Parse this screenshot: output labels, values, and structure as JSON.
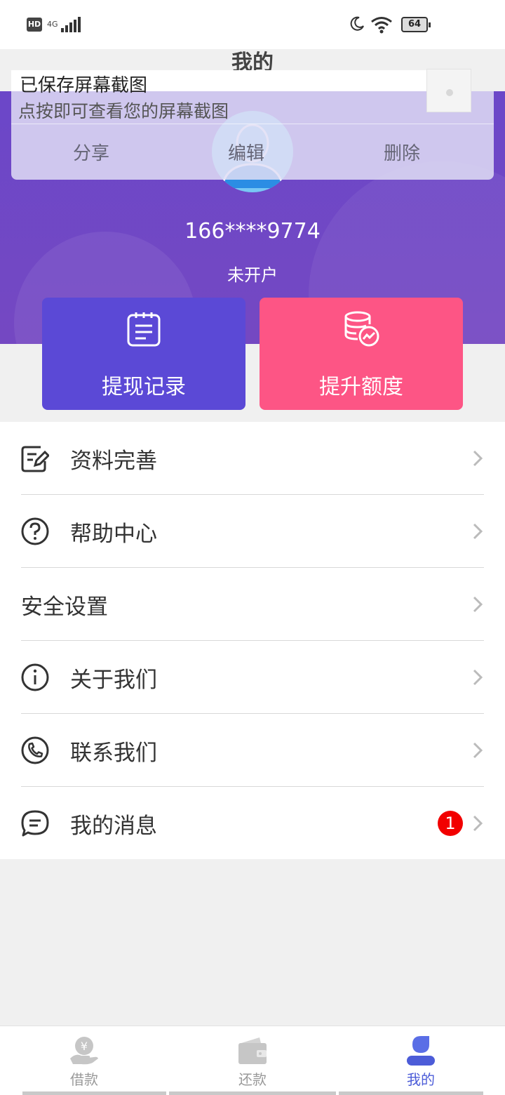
{
  "status_bar": {
    "hd": "HD",
    "network": "4G",
    "battery": "64"
  },
  "page": {
    "title": "我的"
  },
  "toast": {
    "title": "已保存屏幕截图",
    "subtitle": "点按即可查看您的屏幕截图",
    "actions": [
      "分享",
      "编辑",
      "删除"
    ]
  },
  "profile": {
    "phone": "166****9774",
    "status": "未开户"
  },
  "cards": {
    "withdraw_label": "提现记录",
    "limit_label": "提升额度"
  },
  "menu": {
    "items": [
      {
        "label": "资料完善",
        "icon": "edit-doc-icon"
      },
      {
        "label": "帮助中心",
        "icon": "help-icon"
      },
      {
        "label": "安全设置",
        "icon": ""
      },
      {
        "label": "关于我们",
        "icon": "info-icon"
      },
      {
        "label": "联系我们",
        "icon": "phone-icon"
      },
      {
        "label": "我的消息",
        "icon": "message-icon",
        "badge": "1"
      }
    ]
  },
  "nav": {
    "items": [
      {
        "label": "借款",
        "icon": "loan-icon"
      },
      {
        "label": "还款",
        "icon": "wallet-icon"
      },
      {
        "label": "我的",
        "icon": "user-icon",
        "active": true
      }
    ]
  },
  "colors": {
    "purple": "#5b49d6",
    "pink": "#fd5585",
    "active_nav": "#4c5cd8",
    "badge": "#f20000"
  }
}
